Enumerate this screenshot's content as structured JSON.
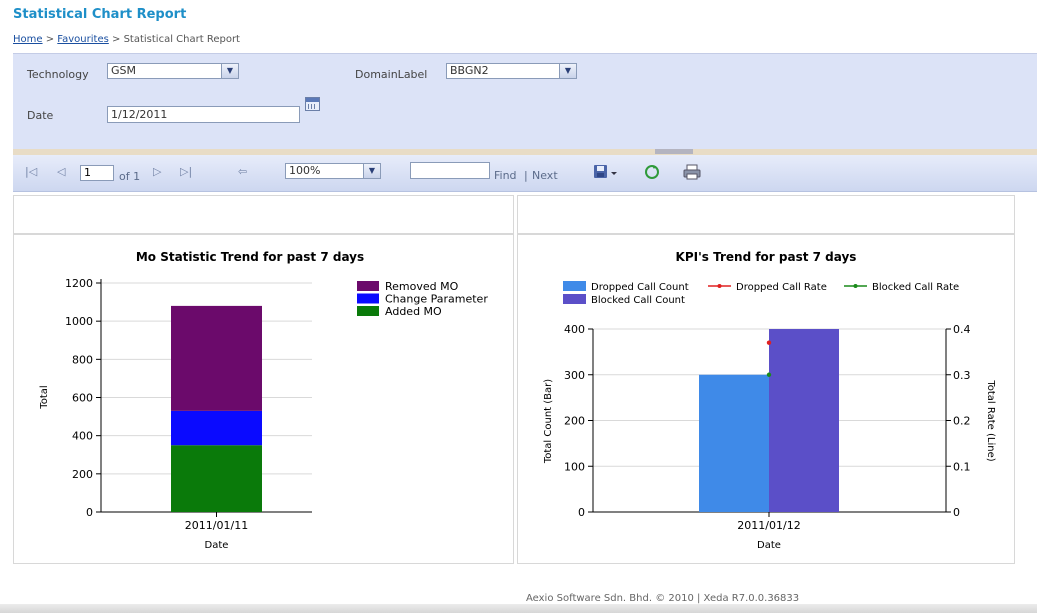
{
  "page": {
    "title": "Statistical Chart Report",
    "breadcrumb": {
      "home": "Home",
      "sep1": ">",
      "favourites": "Favourites",
      "sep2": ">",
      "current": "Statistical Chart Report"
    }
  },
  "params": {
    "technology_label": "Technology",
    "technology_value": "GSM",
    "domain_label": "DomainLabel",
    "domain_value": "BBGN2",
    "date_label": "Date",
    "date_value": "1/12/2011"
  },
  "toolbar": {
    "page_value": "1",
    "of_label": "of 1",
    "zoom_value": "100%",
    "find_label": "Find",
    "sep": "|",
    "next_label": "Next"
  },
  "chart_data": [
    {
      "type": "bar",
      "title": "Mo Statistic Trend for past 7 days",
      "xlabel": "Date",
      "ylabel": "Total",
      "categories": [
        "2011/01/11"
      ],
      "series": [
        {
          "name": "Removed MO",
          "values": [
            550
          ],
          "color": "#6b0a6b"
        },
        {
          "name": "Change Parameter",
          "values": [
            180
          ],
          "color": "#0a0aff"
        },
        {
          "name": "Added MO",
          "values": [
            350
          ],
          "color": "#0a7a0a"
        }
      ],
      "stacked": true,
      "stack_order_bottom_up": [
        "Added MO",
        "Change Parameter",
        "Removed MO"
      ],
      "ylim": [
        0,
        1200
      ],
      "yticks": [
        "0",
        "200",
        "400",
        "600",
        "800",
        "1000",
        "1200"
      ],
      "legend": "right",
      "grid": true
    },
    {
      "type": "bar",
      "title": "KPI's Trend for past 7 days",
      "xlabel": "Date",
      "ylabel": "Total Count (Bar)",
      "y2label": "Total Rate (Line)",
      "categories": [
        "2011/01/12"
      ],
      "series": [
        {
          "name": "Dropped Call Count",
          "values": [
            300
          ],
          "color": "#3f8ae8",
          "kind": "bar"
        },
        {
          "name": "Blocked Call Count",
          "values": [
            400
          ],
          "color": "#5b4fc8",
          "kind": "bar"
        },
        {
          "name": "Dropped Call Rate",
          "values": [
            0.37
          ],
          "color": "#e02020",
          "kind": "line",
          "axis": "right"
        },
        {
          "name": "Blocked Call Rate",
          "values": [
            0.3
          ],
          "color": "#1a8a1a",
          "kind": "line",
          "axis": "right"
        }
      ],
      "ylim": [
        0,
        400
      ],
      "y2lim": [
        0,
        0.4
      ],
      "yticks": [
        "0",
        "100",
        "200",
        "300",
        "400"
      ],
      "y2ticks": [
        "0",
        "0.1",
        "0.2",
        "0.3",
        "0.4"
      ],
      "legend": "top",
      "grid": true
    }
  ],
  "footer": {
    "text": "Aexio Software Sdn. Bhd. © 2010 | Xeda R7.0.0.36833"
  }
}
